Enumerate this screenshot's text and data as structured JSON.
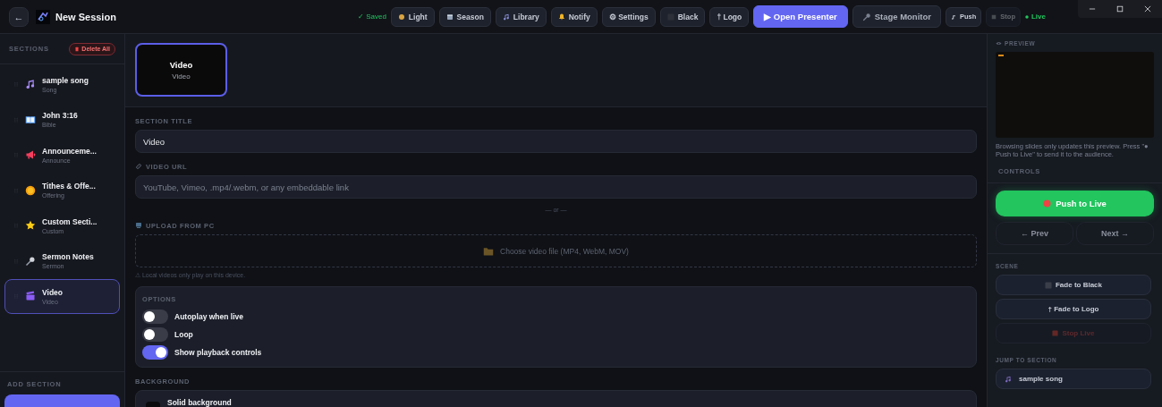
{
  "header": {
    "back": "←",
    "title": "New Session",
    "saved": "✓ Saved",
    "toolbar": [
      {
        "kind": "light",
        "label": "Light",
        "disabled": false
      },
      {
        "kind": "season",
        "label": "Season",
        "disabled": false
      },
      {
        "kind": "library",
        "label": "Library",
        "disabled": false
      },
      {
        "kind": "notify",
        "label": "Notify",
        "disabled": false
      },
      {
        "kind": "plain",
        "label": "⚙ Settings",
        "disabled": false
      },
      {
        "kind": "black",
        "label": "Black",
        "disabled": false
      },
      {
        "kind": "plain",
        "label": "† Logo",
        "disabled": false
      },
      {
        "kind": "primary",
        "label": "▶ Open Presenter",
        "disabled": false
      },
      {
        "kind": "monitor",
        "label": "Stage Monitor",
        "disabled": false
      },
      {
        "kind": "push",
        "label": "Push",
        "disabled": false
      },
      {
        "kind": "stop",
        "label": "Stop",
        "disabled": true
      }
    ],
    "live": "Live"
  },
  "sidebar": {
    "heading": "SECTIONS",
    "delete_all": "Delete All",
    "items": [
      {
        "kind": "song",
        "title": "sample song",
        "type": "Song",
        "selected": false
      },
      {
        "kind": "bible",
        "title": "John 3:16",
        "type": "Bible",
        "selected": false
      },
      {
        "kind": "announce",
        "title": "Announceme...",
        "type": "Announce",
        "selected": false
      },
      {
        "kind": "offering",
        "title": "Tithes & Offe...",
        "type": "Offering",
        "selected": false
      },
      {
        "kind": "custom",
        "title": "Custom Secti...",
        "type": "Custom",
        "selected": false
      },
      {
        "kind": "sermon",
        "title": "Sermon Notes",
        "type": "Sermon",
        "selected": false
      },
      {
        "kind": "video",
        "title": "Video",
        "type": "Video",
        "selected": true
      }
    ],
    "add_heading": "ADD SECTION"
  },
  "editor": {
    "card": {
      "title": "Video",
      "type": "Video",
      "selected": true
    },
    "section_title": {
      "label": "SECTION TITLE",
      "value": "Video"
    },
    "video_url": {
      "label": "VIDEO URL",
      "placeholder": "YouTube, Vimeo, .mp4/.webm, or any embeddable link"
    },
    "divider": "— or —",
    "upload": {
      "label": "UPLOAD FROM PC",
      "button": "Choose video file (MP4, WebM, MOV)",
      "note": "⚠ Local videos only play on this device."
    },
    "options": {
      "heading": "OPTIONS",
      "toggles": [
        {
          "label": "Autoplay when live",
          "on": false
        },
        {
          "label": "Loop",
          "on": false
        },
        {
          "label": "Show playback controls",
          "on": true
        }
      ]
    },
    "background": {
      "heading": "BACKGROUND",
      "option": "Solid background"
    }
  },
  "live_panel": {
    "preview": {
      "heading": "PREVIEW",
      "hint": "Browsing slides only updates this preview. Press \"● Push to Live\" to send it to the audience."
    },
    "controls": {
      "heading": "CONTROLS",
      "push": "Push to Live",
      "nav": [
        {
          "label": "← Prev",
          "disabled": true
        },
        {
          "label": "Next →",
          "disabled": true
        }
      ]
    },
    "scene": {
      "heading": "SCENE",
      "buttons": [
        {
          "kind": "black",
          "label": "Fade to Black",
          "disabled": false
        },
        {
          "kind": "plain",
          "label": "† Fade to Logo",
          "disabled": false
        },
        {
          "kind": "stop",
          "label": "Stop Live",
          "disabled": true
        }
      ]
    },
    "jump": {
      "heading": "JUMP TO SECTION",
      "items": [
        {
          "kind": "song",
          "label": "sample song"
        }
      ]
    }
  }
}
